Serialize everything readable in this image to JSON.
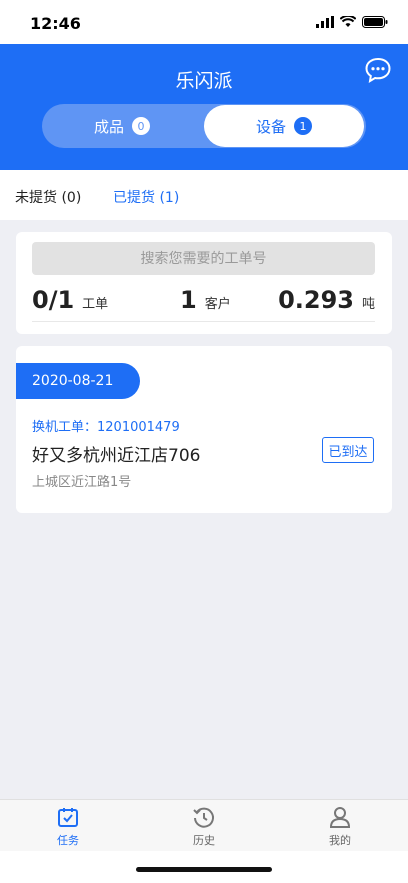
{
  "status_bar": {
    "time": "12:46"
  },
  "header": {
    "title": "乐闪派",
    "segments": [
      {
        "label": "成品",
        "badge": "0"
      },
      {
        "label": "设备",
        "badge": "1"
      }
    ]
  },
  "subtabs": [
    {
      "label": "未提货 (0)"
    },
    {
      "label": "已提货 (1)"
    }
  ],
  "summary": {
    "search_placeholder": "搜索您需要的工单号",
    "stats": [
      {
        "value": "0/1",
        "unit": "工单"
      },
      {
        "value": "1",
        "unit": "客户"
      },
      {
        "value": "0.293",
        "unit": "吨"
      }
    ]
  },
  "order": {
    "date": "2020-08-21",
    "work_order": "换机工单：1201001479",
    "store": "好又多杭州近江店706",
    "address": "上城区近江路1号",
    "status": "已到达"
  },
  "bottom_nav": [
    {
      "label": "任务",
      "icon": "calendar-check-icon"
    },
    {
      "label": "历史",
      "icon": "history-icon"
    },
    {
      "label": "我的",
      "icon": "user-icon"
    }
  ],
  "colors": {
    "primary": "#1e6ef5",
    "segment_bg": "#5f95f4",
    "page_bg": "#eeeff4"
  }
}
